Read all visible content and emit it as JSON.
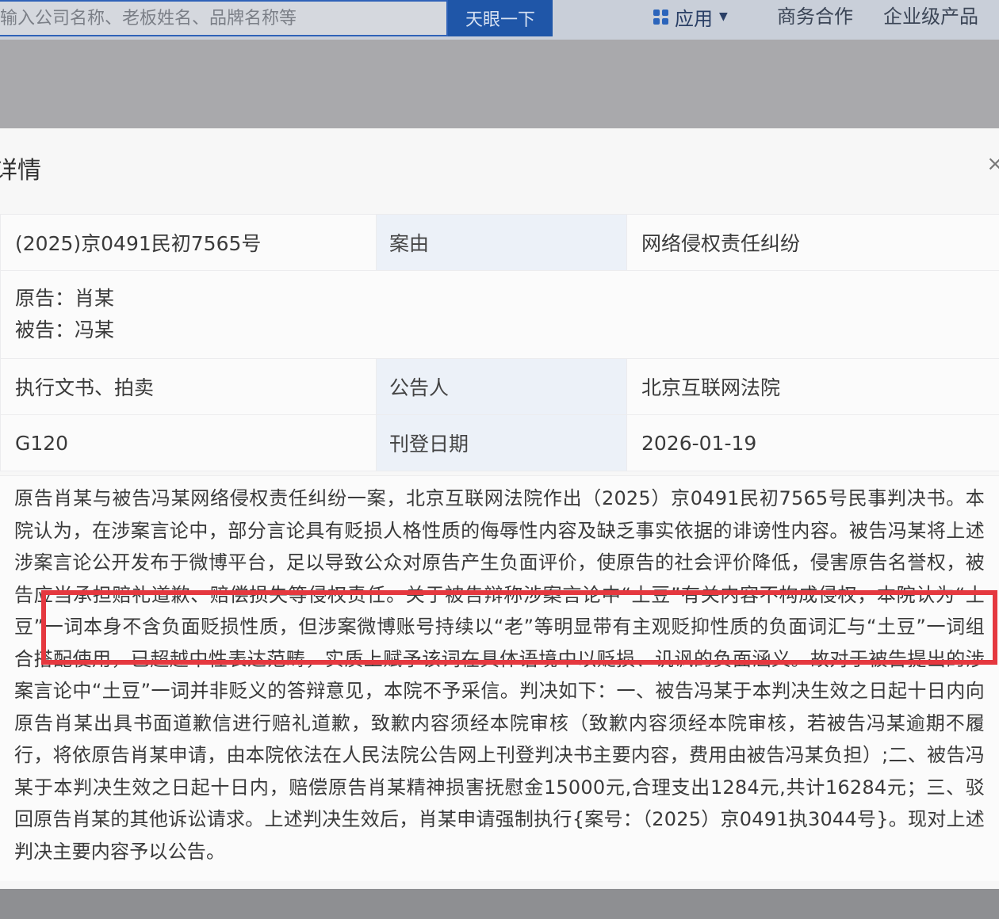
{
  "search": {
    "placeholder": "输入公司名称、老板姓名、品牌名称等",
    "button_label": "天眼一下"
  },
  "nav": {
    "apps_label": "应用",
    "business_label": "商务合作",
    "enterprise_label": "企业级产品"
  },
  "modal": {
    "title": "详情",
    "close_symbol": "×",
    "rows": {
      "case_number": "(2025)京0491民初7565号",
      "cause_label": "案由",
      "cause_value": "网络侵权责任纠纷",
      "plaintiff": "原告：肖某",
      "defendant": "被告：冯某",
      "type_value": "执行文书、拍卖",
      "announcer_label": "公告人",
      "announcer_value": "北京互联网法院",
      "layout_code": "G120",
      "publish_date_label": "刊登日期",
      "publish_date_value": "2026-01-19"
    },
    "content": "原告肖某与被告冯某网络侵权责任纠纷一案，北京互联网法院作出（2025）京0491民初7565号民事判决书。本院认为，在涉案言论中，部分言论具有贬损人格性质的侮辱性内容及缺乏事实依据的诽谤性内容。被告冯某将上述涉案言论公开发布于微博平台，足以导致公众对原告产生负面评价，使原告的社会评价降低，侵害原告名誉权，被告应当承担赔礼道歉、赔偿损失等侵权责任。关于被告辩称涉案言论中“土豆”有关内容不构成侵权，本院认为“土豆”一词本身不含负面贬损性质，但涉案微博账号持续以“老”等明显带有主观贬抑性质的负面词汇与“土豆”一词组合搭配使用，已超越中性表达范畴，实质上赋予该词在具体语境中以贬损、讥讽的负面涵义。故对于被告提出的涉案言论中“土豆”一词并非贬义的答辩意见，本院不予采信。判决如下：一、被告冯某于本判决生效之日起十日内向原告肖某出具书面道歉信进行赔礼道歉，致歉内容须经本院审核（致歉内容须经本院审核，若被告冯某逾期不履行，将依原告肖某申请，由本院依法在人民法院公告网上刊登判决书主要内容，费用由被告冯某负担）;二、被告冯某于本判决生效之日起十日内，赔偿原告肖某精神损害抚慰金15000元,合理支出1284元,共计16284元；三、驳回原告肖某的其他诉讼请求。上述判决生效后，肖某申请强制执行{案号：（2025）京0491执3044号}。现对上述判决主要内容予以公告。"
  },
  "colors": {
    "accent_blue": "#1f56a8",
    "highlight_red": "#e5383f",
    "label_cell_bg": "#ecf1f8"
  }
}
